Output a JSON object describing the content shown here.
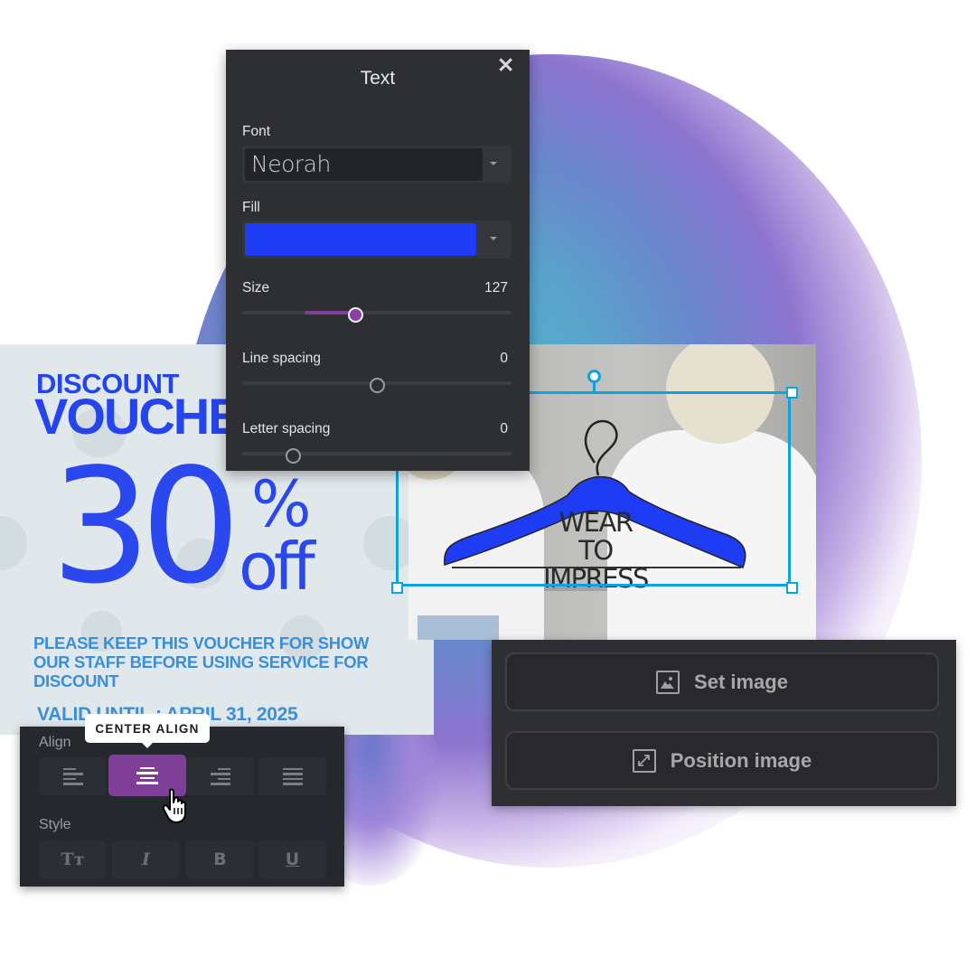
{
  "voucher": {
    "title_line1": "DISCOUNT",
    "title_line2": "VOUCHER",
    "big_number": "30",
    "percent": "%",
    "off": "off",
    "body": "PLEASE KEEP THIS VOUCHER FOR SHOW OUR STAFF BEFORE USING SERVICE FOR DISCOUNT",
    "valid": "VALID UNTIL : APRIL 31, 2025",
    "text_color": "#2444ec",
    "body_color": "#3b8fd6"
  },
  "canvas_logo": {
    "line1": "WEAR TO",
    "line2": "IMPRESS",
    "hanger_color": "#1f3cf5"
  },
  "text_panel": {
    "title": "Text",
    "close_icon": "close-icon",
    "font": {
      "label": "Font",
      "value": "Neorah"
    },
    "fill": {
      "label": "Fill",
      "color": "#1f3cf5"
    },
    "size": {
      "label": "Size",
      "value": "127",
      "fill_from": 0.23,
      "fill_to": 0.42
    },
    "line_spacing": {
      "label": "Line spacing",
      "value": "0",
      "position": 0.5
    },
    "letter_spacing": {
      "label": "Letter spacing",
      "value": "0",
      "position": 0.19
    }
  },
  "align_panel": {
    "align_label": "Align",
    "align_options": [
      {
        "name": "left-align",
        "icon": "align-left-icon"
      },
      {
        "name": "center-align",
        "icon": "align-center-icon",
        "active": true
      },
      {
        "name": "right-align",
        "icon": "align-right-icon"
      },
      {
        "name": "justify",
        "icon": "align-justify-icon"
      }
    ],
    "tooltip": "CENTER ALIGN",
    "style_label": "Style",
    "style_options": [
      {
        "name": "text-transform",
        "glyph": "Tт"
      },
      {
        "name": "italic",
        "glyph": "I"
      },
      {
        "name": "bold",
        "glyph": "B"
      },
      {
        "name": "underline",
        "glyph": "U"
      }
    ],
    "accent": "#7f3e97"
  },
  "image_panel": {
    "set_image": "Set image",
    "position_image": "Position image"
  }
}
